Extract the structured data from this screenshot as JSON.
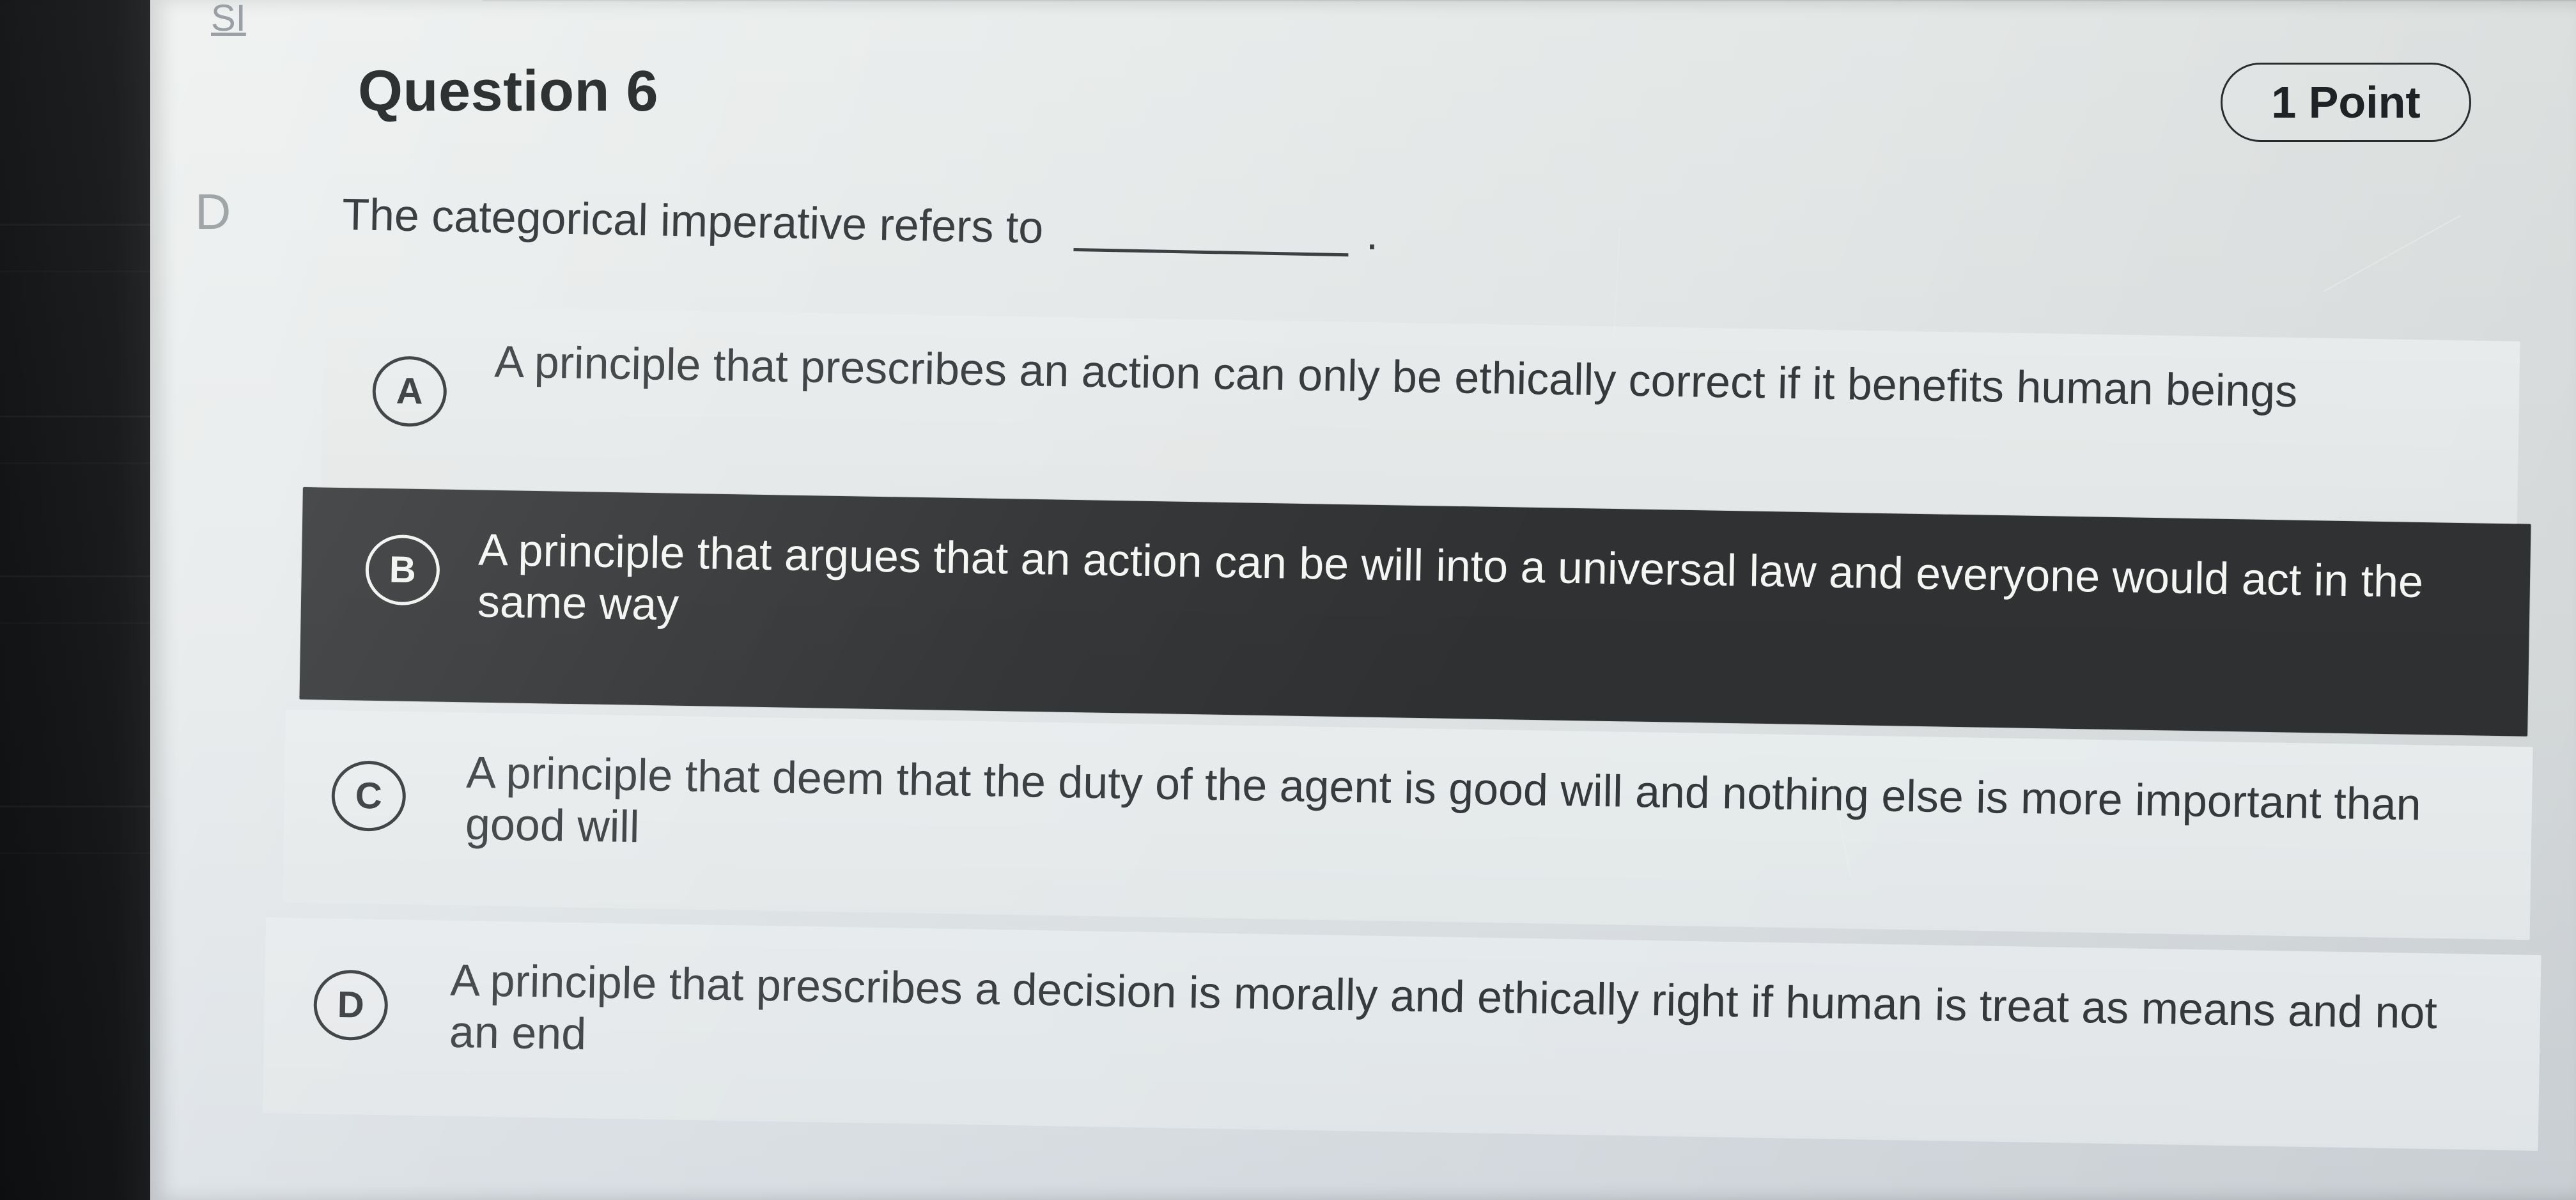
{
  "page": {
    "nav_fragment": "SI",
    "side_letter": "D"
  },
  "question": {
    "title": "Question 6",
    "points": "1 Point",
    "prompt_text": "The categorical imperative refers to",
    "prompt_suffix": "."
  },
  "options": [
    {
      "letter": "A",
      "text": "A principle that prescribes an action can only be ethically correct if it benefits human beings",
      "selected": false
    },
    {
      "letter": "B",
      "text": "A principle that argues that an action can be will into a universal law and everyone would act in the same way",
      "selected": true
    },
    {
      "letter": "C",
      "text": "A principle that deem that the duty of the agent is good will and nothing else is more important than good will",
      "selected": false
    },
    {
      "letter": "D",
      "text": "A principle that prescribes a decision is morally and ethically right if human is treat as means and not an end",
      "selected": false
    }
  ],
  "colors": {
    "selected_background": "#2f3133",
    "selected_text": "#f6f6f4",
    "option_background": "#e8ebeb",
    "primary_text": "#2f3233"
  }
}
